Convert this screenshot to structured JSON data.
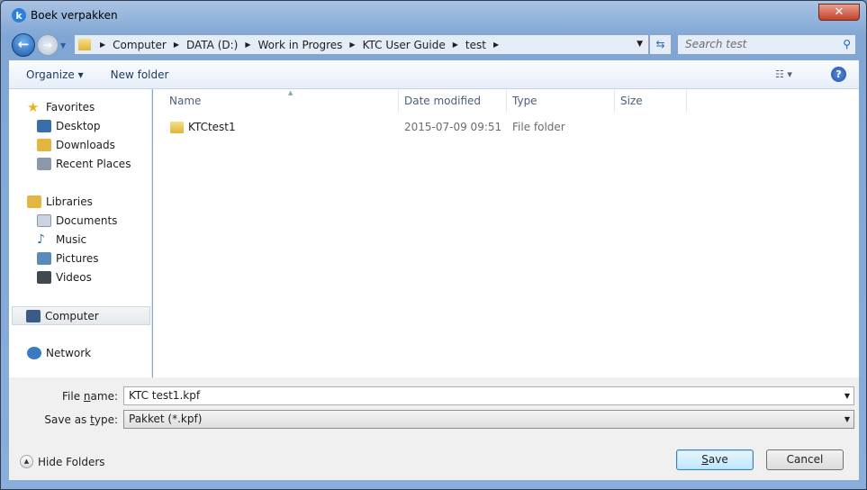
{
  "window": {
    "title": "Boek verpakken",
    "close": "✕"
  },
  "nav": {
    "back": "←",
    "forward": "→"
  },
  "address": {
    "crumbs": [
      "Computer",
      "DATA (D:)",
      "Work in Progres",
      "KTC User Guide",
      "test"
    ]
  },
  "search": {
    "placeholder": "Search test"
  },
  "toolbar": {
    "organize": "Organize ▾",
    "new_folder": "New folder",
    "views": "☷ ▾",
    "help": "?"
  },
  "sidebar": {
    "items": [
      {
        "label": "Favorites",
        "icon": "star-icon",
        "color": "#f0b020"
      },
      {
        "label": "Desktop",
        "icon": "desktop-icon",
        "color": "#3a6ea8"
      },
      {
        "label": "Downloads",
        "icon": "downloads-icon",
        "color": "#e2b640"
      },
      {
        "label": "Recent Places",
        "icon": "recent-places-icon",
        "color": "#8a98a8"
      },
      {
        "label": "Libraries",
        "icon": "libraries-icon",
        "color": "#e2b640"
      },
      {
        "label": "Documents",
        "icon": "documents-icon",
        "color": "#c9d4e0"
      },
      {
        "label": "Music",
        "icon": "music-icon",
        "color": "#2f6fc0"
      },
      {
        "label": "Pictures",
        "icon": "pictures-icon",
        "color": "#5a8ab8"
      },
      {
        "label": "Videos",
        "icon": "videos-icon",
        "color": "#404850"
      },
      {
        "label": "Computer",
        "icon": "computer-icon",
        "color": "#3a5a88"
      },
      {
        "label": "Network",
        "icon": "network-icon",
        "color": "#3a7ac0"
      }
    ]
  },
  "columns": [
    "Name",
    "Date modified",
    "Type",
    "Size"
  ],
  "files": [
    {
      "name": "KTCtest1",
      "date": "2015-07-09 09:51",
      "type": "File folder",
      "size": ""
    }
  ],
  "form": {
    "file_name_label_pre": "File ",
    "file_name_label_u": "n",
    "file_name_label_post": "ame:",
    "file_name": "KTC test1.kpf",
    "type_label_pre": "Save as ",
    "type_label_u": "t",
    "type_label_post": "ype:",
    "type_value": "Pakket (*.kpf)"
  },
  "footer": {
    "hide_folders": "Hide Folders",
    "save_u": "S",
    "save_rest": "ave",
    "cancel": "Cancel"
  }
}
